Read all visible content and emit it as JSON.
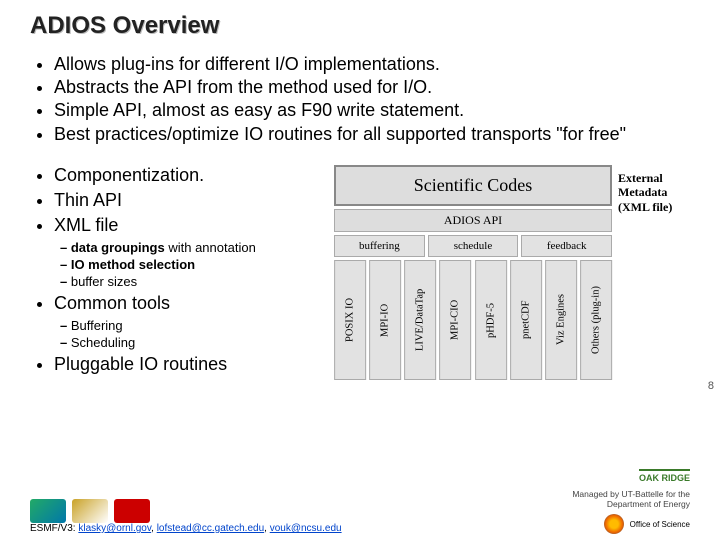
{
  "title": "ADIOS Overview",
  "bullets_top": [
    "Allows plug-ins for different I/O implementations.",
    "Abstracts the API from the method used for I/O.",
    "Simple API, almost as easy as F90 write statement.",
    "Best practices/optimize IO routines for all supported transports \"for free\""
  ],
  "bullets_left": {
    "items": [
      "Componentization.",
      "Thin API",
      "XML file"
    ],
    "xml_sub": [
      {
        "bold": "data groupings",
        "rest": " with annotation"
      },
      {
        "bold": "IO method selection",
        "rest": ""
      },
      {
        "bold": "",
        "rest": "buffer sizes"
      }
    ],
    "common": "Common tools",
    "common_sub": [
      "Buffering",
      "Scheduling"
    ],
    "pluggable": "Pluggable IO routines"
  },
  "diagram": {
    "scientific": "Scientific Codes",
    "api": "ADIOS API",
    "row3": [
      "buffering",
      "schedule",
      "feedback"
    ],
    "transports": [
      "POSIX IO",
      "MPI-IO",
      "LIVE/DataTap",
      "MPI-CIO",
      "pHDF-5",
      "pnetCDF",
      "Viz Engines",
      "Others (plug-in)"
    ],
    "ext_meta": [
      "External",
      "Metadata",
      "(XML file)"
    ]
  },
  "page_num": "8",
  "footer": {
    "refs_prefix": "ESMF/V3: ",
    "emails": [
      "klasky@ornl.gov",
      "lofstead@cc.gatech.edu",
      "vouk@ncsu.edu"
    ],
    "ornl": "OAK RIDGE",
    "office": "Office of Science",
    "managed": "Managed by UT-Battelle for the Department of Energy"
  }
}
